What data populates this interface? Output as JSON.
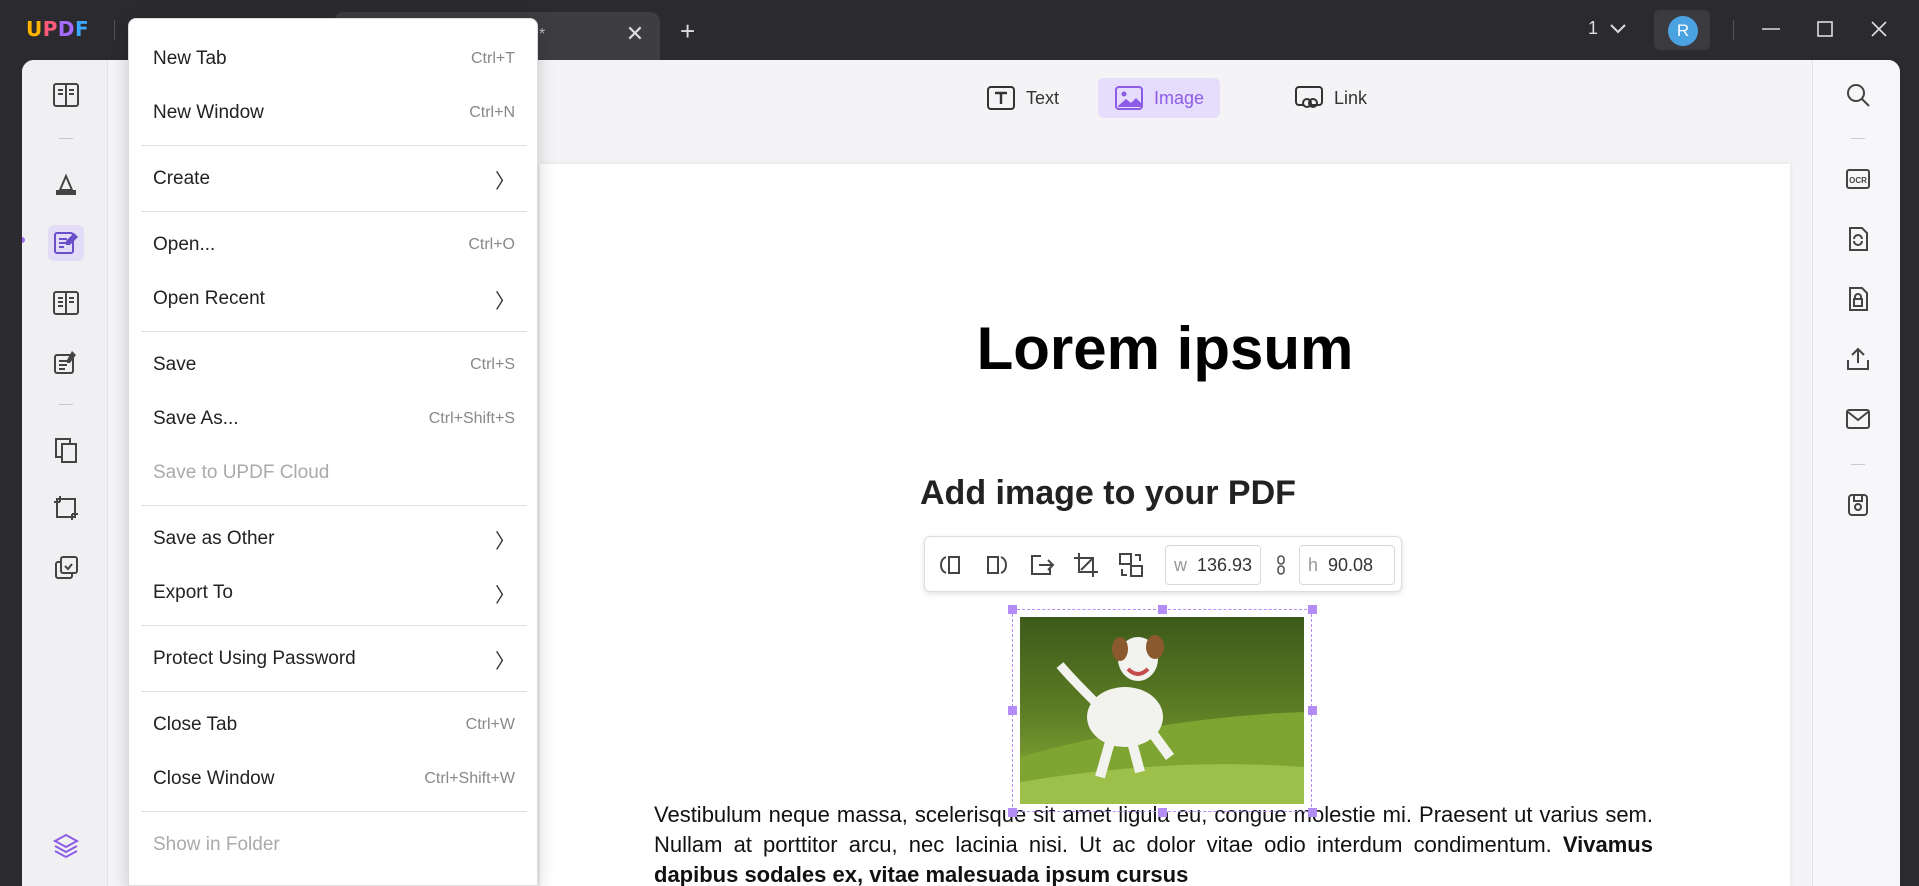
{
  "app": {
    "logo_letters": [
      "U",
      "P",
      "D",
      "F"
    ],
    "tab_title": "*",
    "page_number": "1",
    "avatar_initial": "R"
  },
  "edit_toolbar": {
    "text_label": "Text",
    "image_label": "Image",
    "link_label": "Link"
  },
  "document": {
    "title": "Lorem ipsum",
    "subtitle_partial": "Add image to your PDF",
    "paragraph_normal": "Vestibulum neque massa, scelerisque sit amet ligula eu, congue molestie mi. Praesent ut varius sem. Nullam at porttitor arcu, nec lacinia nisi. Ut ac dolor vitae odio interdum condimentum. ",
    "paragraph_bold": "Vivamus dapibus sodales ex, vitae malesuada ipsum cursus"
  },
  "image_toolbar": {
    "width_label": "w",
    "width_value": "136.93",
    "height_label": "h",
    "height_value": "90.08"
  },
  "menu": {
    "items": [
      {
        "label": "New Tab",
        "shortcut": "Ctrl+T"
      },
      {
        "label": "New Window",
        "shortcut": "Ctrl+N"
      },
      {
        "label": "Create",
        "submenu": true
      },
      {
        "label": "Open...",
        "shortcut": "Ctrl+O"
      },
      {
        "label": "Open Recent",
        "submenu": true
      },
      {
        "label": "Save",
        "shortcut": "Ctrl+S"
      },
      {
        "label": "Save As...",
        "shortcut": "Ctrl+Shift+S"
      },
      {
        "label": "Save to UPDF Cloud",
        "disabled": true
      },
      {
        "label": "Save as Other",
        "submenu": true
      },
      {
        "label": "Export To",
        "submenu": true
      },
      {
        "label": "Protect Using Password",
        "submenu": true
      },
      {
        "label": "Close Tab",
        "shortcut": "Ctrl+W"
      },
      {
        "label": "Close Window",
        "shortcut": "Ctrl+Shift+W"
      },
      {
        "label": "Show in Folder",
        "disabled": true
      }
    ]
  },
  "colors": {
    "accent": "#9b6cf0",
    "selection": "#b48cf5",
    "titlebar": "#2b2b2f",
    "avatar": "#4aa3e0"
  }
}
